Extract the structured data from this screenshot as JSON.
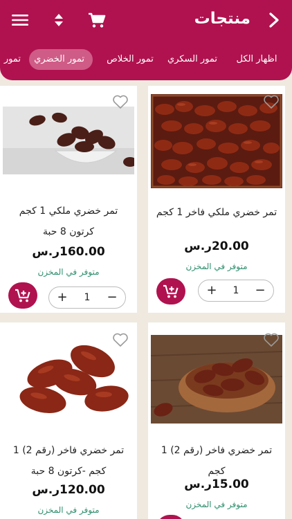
{
  "header": {
    "title": "منتجات",
    "back_icon": "chevron-right-icon",
    "menu_icon": "hamburger-menu-icon",
    "sort_icon": "sort-icon",
    "cart_icon": "cart-icon"
  },
  "categories": [
    {
      "label": "اظهار الكل",
      "active": false
    },
    {
      "label": "تمور السكري",
      "active": false
    },
    {
      "label": "تمور الخلاص",
      "active": false
    },
    {
      "label": "تمور الخضري",
      "active": true
    },
    {
      "label": "تمور",
      "active": false
    }
  ],
  "products": [
    {
      "name": "تمر خضري ملكي فاخر 1 كجم",
      "price": "20.00ر.س",
      "stock": "متوفر في المخزن",
      "qty": "1"
    },
    {
      "name": "تمر خضري ملكي 1 كجم كرتون 8 حبة",
      "price": "160.00ر.س",
      "stock": "متوفر في المخزن",
      "qty": "1"
    },
    {
      "name": "تمر خضري فاخر (رقم 2) 1 كجم",
      "price": "15.00ر.س",
      "stock": "متوفر في المخزن",
      "qty": "1"
    },
    {
      "name": "تمر خضري فاخر (رقم 2) 1 كجم -كرتون 8 حبة",
      "price": "120.00ر.س",
      "stock": "متوفر في المخزن",
      "qty": "1"
    }
  ],
  "stepper": {
    "plus": "+",
    "minus": "−"
  },
  "colors": {
    "brand": "#b0124f",
    "active_tab": "#cf5c86",
    "stock": "#2e8f6f",
    "background": "#efe9df"
  }
}
